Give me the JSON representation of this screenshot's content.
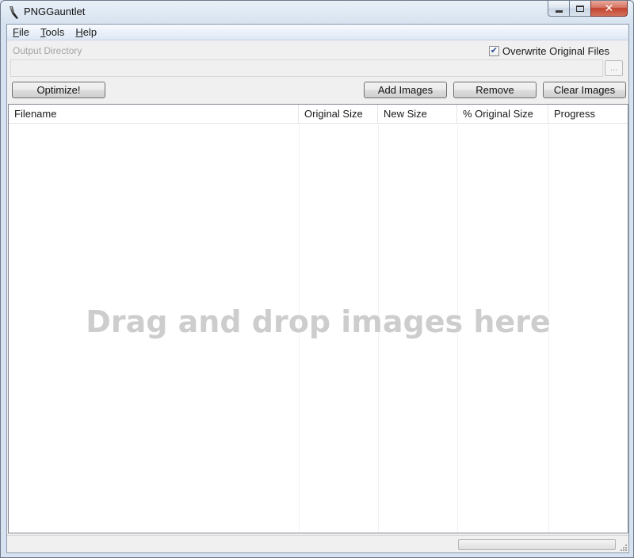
{
  "window": {
    "title": "PNGGauntlet",
    "icon": "brush-icon"
  },
  "menu": {
    "file": {
      "key": "F",
      "rest": "ile"
    },
    "tools": {
      "key": "T",
      "rest": "ools"
    },
    "help": {
      "key": "H",
      "rest": "elp"
    }
  },
  "output": {
    "label": "Output Directory",
    "value": "",
    "browse_label": "..."
  },
  "overwrite": {
    "label": "Overwrite Original Files",
    "checked": true
  },
  "buttons": {
    "optimize": "Optimize!",
    "add_images": "Add Images",
    "remove": "Remove",
    "clear_images": "Clear Images"
  },
  "table": {
    "columns": [
      "Filename",
      "Original Size",
      "New Size",
      "% Original Size",
      "Progress"
    ],
    "rows": [],
    "drop_hint": "Drag and drop images here"
  },
  "status": {
    "progress_percent": 0
  },
  "colors": {
    "drop_hint": "#cdcdcd",
    "menu_bar": "#dde8f5"
  }
}
